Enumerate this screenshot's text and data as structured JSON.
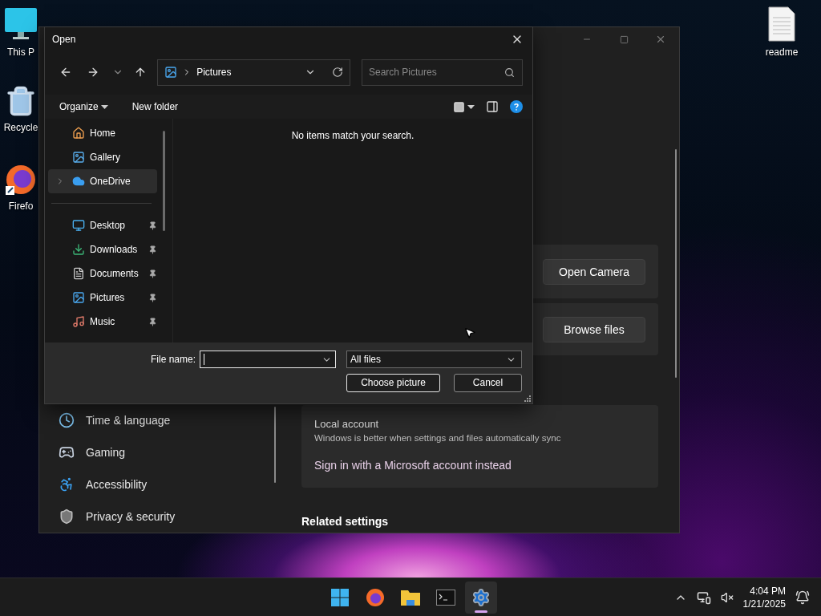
{
  "desktop_icons": [
    {
      "label": "This P",
      "kind": "computer"
    },
    {
      "label": "Recycle",
      "kind": "recycle"
    },
    {
      "label": "Firefo",
      "kind": "browser"
    },
    {
      "label": "readme",
      "kind": "document"
    }
  ],
  "settings": {
    "nav_items": [
      {
        "label": "Time & language",
        "kind": "time"
      },
      {
        "label": "Gaming",
        "kind": "gaming"
      },
      {
        "label": "Accessibility",
        "kind": "accessibility"
      },
      {
        "label": "Privacy & security",
        "kind": "privacy"
      }
    ],
    "photo_options": [
      {
        "button": "Open Camera"
      },
      {
        "button": "Browse files"
      }
    ],
    "account": {
      "title": "Local account",
      "description": "Windows is better when settings and files automatically sync",
      "link": "Sign in with a Microsoft account instead"
    },
    "related_heading": "Related settings"
  },
  "dialog": {
    "title": "Open",
    "address": "Pictures",
    "search_placeholder": "Search Pictures",
    "commands": [
      {
        "label": "Organize",
        "kind": "menu"
      },
      {
        "label": "New folder",
        "kind": "action"
      }
    ],
    "nav_sections": [
      {
        "items": [
          {
            "label": "Home",
            "kind": "home",
            "selected": false,
            "expandable": false,
            "pinned": false
          },
          {
            "label": "Gallery",
            "kind": "gallery",
            "selected": false,
            "expandable": false,
            "pinned": false
          },
          {
            "label": "OneDrive",
            "kind": "cloud",
            "selected": true,
            "expandable": true,
            "pinned": false
          }
        ]
      },
      {
        "items": [
          {
            "label": "Desktop",
            "kind": "desktop",
            "selected": false,
            "expandable": false,
            "pinned": true
          },
          {
            "label": "Downloads",
            "kind": "downloads",
            "selected": false,
            "expandable": false,
            "pinned": true
          },
          {
            "label": "Documents",
            "kind": "documents",
            "selected": false,
            "expandable": false,
            "pinned": true
          },
          {
            "label": "Pictures",
            "kind": "pictures",
            "selected": false,
            "expandable": false,
            "pinned": true
          },
          {
            "label": "Music",
            "kind": "music",
            "selected": false,
            "expandable": false,
            "pinned": true
          }
        ]
      }
    ],
    "empty_message": "No items match your search.",
    "file_name_label": "File name:",
    "file_type": "All files",
    "buttons": [
      {
        "label": "Choose picture",
        "kind": "primary"
      },
      {
        "label": "Cancel",
        "kind": "secondary"
      }
    ]
  },
  "taskbar": {
    "apps": [
      {
        "kind": "start",
        "selected": false
      },
      {
        "kind": "browser",
        "selected": false
      },
      {
        "kind": "folder",
        "selected": false
      },
      {
        "kind": "terminal",
        "selected": false
      },
      {
        "kind": "settings",
        "selected": true
      }
    ],
    "time": "4:04 PM",
    "date": "1/21/2025"
  }
}
